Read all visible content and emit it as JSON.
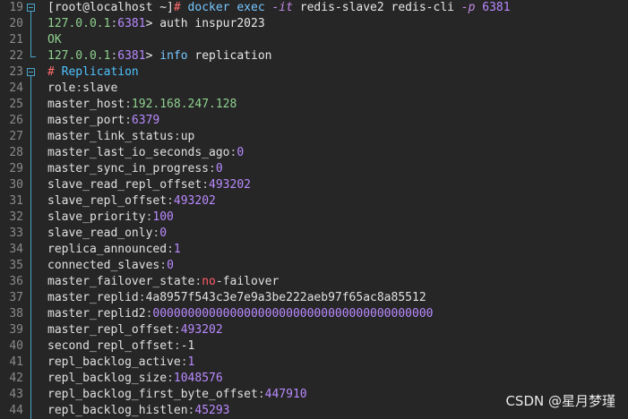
{
  "editor": {
    "lines": [
      {
        "n": "19",
        "parts": [
          {
            "t": "[root@localhost ~]",
            "c": "c-plain"
          },
          {
            "t": "# ",
            "c": "c-hash"
          },
          {
            "t": "docker exec ",
            "c": "c-cmd"
          },
          {
            "t": "-it ",
            "c": "c-flag"
          },
          {
            "t": "redis-slave2 redis-cli ",
            "c": "c-plain"
          },
          {
            "t": "-p ",
            "c": "c-flag"
          },
          {
            "t": "6381",
            "c": "c-num"
          }
        ]
      },
      {
        "n": "20",
        "parts": [
          {
            "t": "127.0.0.1",
            "c": "c-prompt"
          },
          {
            "t": ":",
            "c": "c-colon"
          },
          {
            "t": "6381",
            "c": "c-num"
          },
          {
            "t": "> auth inspur2023",
            "c": "c-plain"
          }
        ]
      },
      {
        "n": "21",
        "parts": [
          {
            "t": "OK",
            "c": "c-str"
          }
        ]
      },
      {
        "n": "22",
        "parts": [
          {
            "t": "127.0.0.1",
            "c": "c-prompt"
          },
          {
            "t": ":",
            "c": "c-colon"
          },
          {
            "t": "6381",
            "c": "c-num"
          },
          {
            "t": "> ",
            "c": "c-plain"
          },
          {
            "t": "info",
            "c": "c-cmd"
          },
          {
            "t": " replication",
            "c": "c-plain"
          }
        ]
      },
      {
        "n": "23",
        "parts": [
          {
            "t": "# ",
            "c": "c-hash"
          },
          {
            "t": "Replication",
            "c": "c-comment"
          }
        ]
      },
      {
        "n": "24",
        "parts": [
          {
            "t": "role",
            "c": "c-key"
          },
          {
            "t": ":",
            "c": "c-colon"
          },
          {
            "t": "slave",
            "c": "c-key"
          }
        ]
      },
      {
        "n": "25",
        "parts": [
          {
            "t": "master_host",
            "c": "c-key"
          },
          {
            "t": ":",
            "c": "c-colon"
          },
          {
            "t": "192.168.247.128",
            "c": "c-str"
          }
        ]
      },
      {
        "n": "26",
        "parts": [
          {
            "t": "master_port",
            "c": "c-key"
          },
          {
            "t": ":",
            "c": "c-colon"
          },
          {
            "t": "6379",
            "c": "c-num"
          }
        ]
      },
      {
        "n": "27",
        "parts": [
          {
            "t": "master_link_status",
            "c": "c-key"
          },
          {
            "t": ":",
            "c": "c-colon"
          },
          {
            "t": "up",
            "c": "c-key"
          }
        ]
      },
      {
        "n": "28",
        "parts": [
          {
            "t": "master_last_io_seconds_ago",
            "c": "c-key"
          },
          {
            "t": ":",
            "c": "c-colon"
          },
          {
            "t": "0",
            "c": "c-num"
          }
        ]
      },
      {
        "n": "29",
        "parts": [
          {
            "t": "master_sync_in_progress",
            "c": "c-key"
          },
          {
            "t": ":",
            "c": "c-colon"
          },
          {
            "t": "0",
            "c": "c-num"
          }
        ]
      },
      {
        "n": "30",
        "parts": [
          {
            "t": "slave_read_repl_offset",
            "c": "c-key"
          },
          {
            "t": ":",
            "c": "c-colon"
          },
          {
            "t": "493202",
            "c": "c-num"
          }
        ]
      },
      {
        "n": "31",
        "parts": [
          {
            "t": "slave_repl_offset",
            "c": "c-key"
          },
          {
            "t": ":",
            "c": "c-colon"
          },
          {
            "t": "493202",
            "c": "c-num"
          }
        ]
      },
      {
        "n": "32",
        "parts": [
          {
            "t": "slave_priority",
            "c": "c-key"
          },
          {
            "t": ":",
            "c": "c-colon"
          },
          {
            "t": "100",
            "c": "c-num"
          }
        ]
      },
      {
        "n": "33",
        "parts": [
          {
            "t": "slave_read_only",
            "c": "c-key"
          },
          {
            "t": ":",
            "c": "c-colon"
          },
          {
            "t": "0",
            "c": "c-num"
          }
        ]
      },
      {
        "n": "34",
        "parts": [
          {
            "t": "replica_announced",
            "c": "c-key"
          },
          {
            "t": ":",
            "c": "c-colon"
          },
          {
            "t": "1",
            "c": "c-num"
          }
        ]
      },
      {
        "n": "35",
        "parts": [
          {
            "t": "connected_slaves",
            "c": "c-key"
          },
          {
            "t": ":",
            "c": "c-colon"
          },
          {
            "t": "0",
            "c": "c-num"
          }
        ]
      },
      {
        "n": "36",
        "parts": [
          {
            "t": "master_failover_state",
            "c": "c-key"
          },
          {
            "t": ":",
            "c": "c-colon"
          },
          {
            "t": "no",
            "c": "c-kw"
          },
          {
            "t": "-failover",
            "c": "c-key"
          }
        ]
      },
      {
        "n": "37",
        "parts": [
          {
            "t": "master_replid",
            "c": "c-key"
          },
          {
            "t": ":",
            "c": "c-colon"
          },
          {
            "t": "4a8957f543c3e7e9a3be222aeb97f65ac8a85512",
            "c": "c-key"
          }
        ]
      },
      {
        "n": "38",
        "parts": [
          {
            "t": "master_replid2",
            "c": "c-key"
          },
          {
            "t": ":",
            "c": "c-colon"
          },
          {
            "t": "0000000000000000000000000000000000000000",
            "c": "c-num"
          }
        ]
      },
      {
        "n": "39",
        "parts": [
          {
            "t": "master_repl_offset",
            "c": "c-key"
          },
          {
            "t": ":",
            "c": "c-colon"
          },
          {
            "t": "493202",
            "c": "c-num"
          }
        ]
      },
      {
        "n": "40",
        "parts": [
          {
            "t": "second_repl_offset",
            "c": "c-key"
          },
          {
            "t": ":",
            "c": "c-colon"
          },
          {
            "t": "-1",
            "c": "c-key"
          }
        ]
      },
      {
        "n": "41",
        "parts": [
          {
            "t": "repl_backlog_active",
            "c": "c-key"
          },
          {
            "t": ":",
            "c": "c-colon"
          },
          {
            "t": "1",
            "c": "c-num"
          }
        ]
      },
      {
        "n": "42",
        "parts": [
          {
            "t": "repl_backlog_size",
            "c": "c-key"
          },
          {
            "t": ":",
            "c": "c-colon"
          },
          {
            "t": "1048576",
            "c": "c-num"
          }
        ]
      },
      {
        "n": "43",
        "parts": [
          {
            "t": "repl_backlog_first_byte_offset",
            "c": "c-key"
          },
          {
            "t": ":",
            "c": "c-colon"
          },
          {
            "t": "447910",
            "c": "c-num"
          }
        ]
      },
      {
        "n": "44",
        "parts": [
          {
            "t": "repl_backlog_histlen",
            "c": "c-key"
          },
          {
            "t": ":",
            "c": "c-colon"
          },
          {
            "t": "45293",
            "c": "c-num"
          }
        ]
      }
    ]
  },
  "watermark": "CSDN @星月梦瑾"
}
